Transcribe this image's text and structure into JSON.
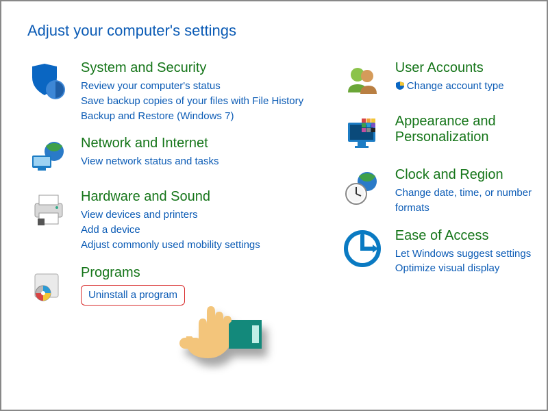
{
  "page_title": "Adjust your computer's settings",
  "categories_left": [
    {
      "title": "System and Security",
      "links": [
        "Review your computer's status",
        "Save backup copies of your files with File History",
        "Backup and Restore (Windows 7)"
      ]
    },
    {
      "title": "Network and Internet",
      "links": [
        "View network status and tasks"
      ]
    },
    {
      "title": "Hardware and Sound",
      "links": [
        "View devices and printers",
        "Add a device",
        "Adjust commonly used mobility settings"
      ]
    },
    {
      "title": "Programs",
      "links": [
        "Uninstall a program"
      ]
    }
  ],
  "categories_right": [
    {
      "title": "User Accounts",
      "links": [
        "Change account type"
      ],
      "shield": true
    },
    {
      "title": "Appearance and Personalization",
      "links": []
    },
    {
      "title": "Clock and Region",
      "links": [
        "Change date, time, or number formats"
      ]
    },
    {
      "title": "Ease of Access",
      "links": [
        "Let Windows suggest settings",
        "Optimize visual display"
      ]
    }
  ],
  "highlighted_link": "Uninstall a program"
}
